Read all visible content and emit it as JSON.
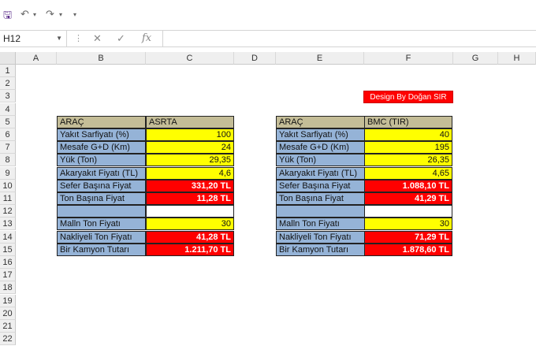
{
  "name_box": "H12",
  "fx_label": "fx",
  "columns": [
    "A",
    "B",
    "C",
    "D",
    "E",
    "F",
    "G",
    "H"
  ],
  "rows": [
    "1",
    "2",
    "3",
    "4",
    "5",
    "6",
    "7",
    "8",
    "9",
    "10",
    "11",
    "12",
    "13",
    "14",
    "15",
    "16",
    "17",
    "18",
    "19",
    "20",
    "21",
    "22"
  ],
  "design_label": "Design By Doğan SIR",
  "table1": {
    "header_label": "ARAÇ",
    "header_value": "ASRTA",
    "labels": [
      "Yakıt Sarfiyatı (%)",
      "Mesafe G+D (Km)",
      "Yük (Ton)",
      "Akaryakıt Fiyatı (TL)",
      "Sefer Başına Fiyat",
      "Ton Başına Fiyat",
      "",
      "Malln Ton Fiyatı",
      "Nakliyeli Ton Fiyatı",
      "Bir Kamyon Tutarı"
    ],
    "values": [
      "100",
      "24",
      "29,35",
      "4,6",
      "331,20 TL",
      "11,28 TL",
      "",
      "30",
      "41,28 TL",
      "1.211,70 TL"
    ]
  },
  "table2": {
    "header_label": "ARAÇ",
    "header_value": "BMC (TIR)",
    "labels": [
      "Yakıt Sarfiyatı (%)",
      "Mesafe G+D (Km)",
      "Yük (Ton)",
      "Akaryakıt Fiyatı (TL)",
      "Sefer Başına Fiyat",
      "Ton Başına Fiyat",
      "",
      "Malln Ton Fiyatı",
      "Nakliyeli Ton Fiyatı",
      "Bir Kamyon Tutarı"
    ],
    "values": [
      "40",
      "195",
      "26,35",
      "4,65",
      "1.088,10 TL",
      "41,29 TL",
      "",
      "30",
      "71,29 TL",
      "1.878,60 TL"
    ]
  },
  "colors": {
    "label_fill": "#95b3d7",
    "header_fill": "#c4bd97",
    "input_fill": "#ffff00",
    "result_fill": "#ff0000"
  }
}
